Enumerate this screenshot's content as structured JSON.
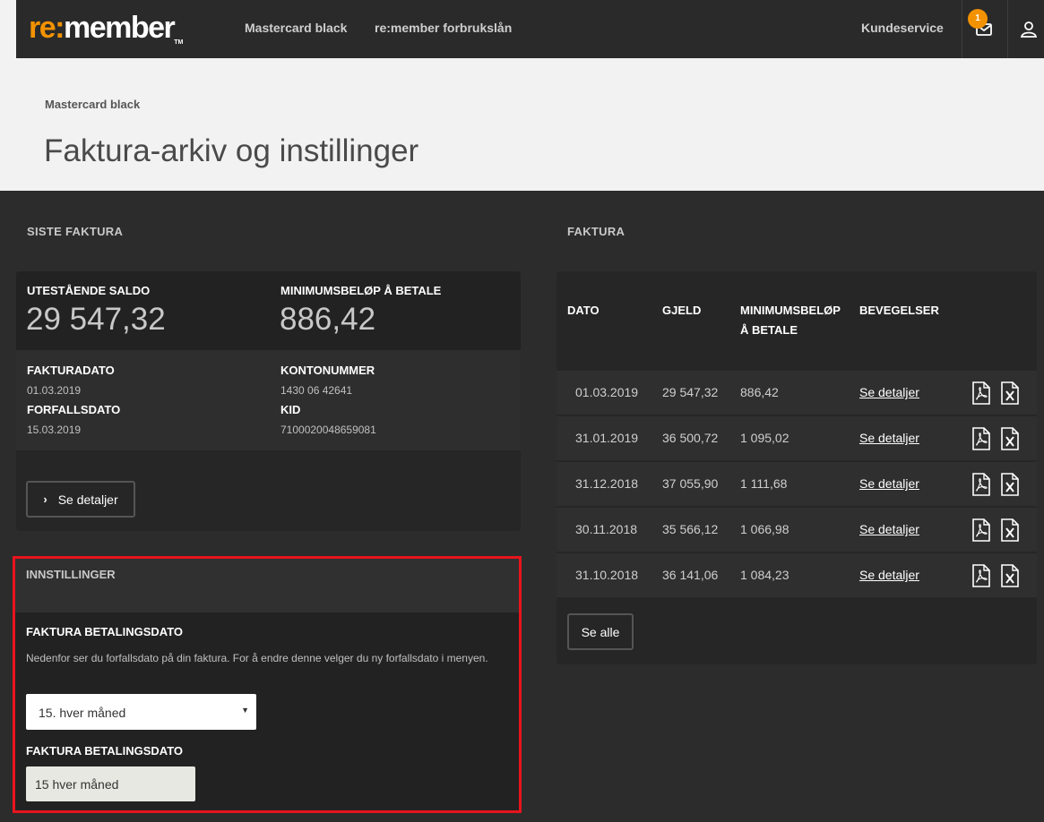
{
  "nav": {
    "logo_re": "re:",
    "logo_member": "member",
    "logo_tm": "TM",
    "link1": "Mastercard black",
    "link2": "re:member forbrukslån",
    "customer_service": "Kundeservice",
    "inbox_badge": "1"
  },
  "header": {
    "breadcrumb": "Mastercard black",
    "title": "Faktura-arkiv og instillinger"
  },
  "latest": {
    "section_title": "SISTE FAKTURA",
    "balance_label": "UTESTÅENDE SALDO",
    "balance_value": "29 547,32",
    "min_label": "MINIMUMSBELØP Å BETALE",
    "min_value": "886,42",
    "invoice_date_label": "FAKTURADATO",
    "invoice_date": "01.03.2019",
    "due_date_label": "FORFALLSDATO",
    "due_date": "15.03.2019",
    "account_label": "KONTONUMMER",
    "account": "1430 06 42641",
    "kid_label": "KID",
    "kid": "7100020048659081",
    "details_button": "Se detaljer"
  },
  "invoices": {
    "section_title": "FAKTURA",
    "headers": {
      "date": "DATO",
      "debt": "GJELD",
      "min_line1": "MINIMUMSBELØP",
      "min_line2": "Å BETALE",
      "movements": "BEVEGELSER"
    },
    "link_label": "Se detaljer",
    "rows": [
      {
        "date": "01.03.2019",
        "debt": "29 547,32",
        "min": "886,42"
      },
      {
        "date": "31.01.2019",
        "debt": "36 500,72",
        "min": "1 095,02"
      },
      {
        "date": "31.12.2018",
        "debt": "37 055,90",
        "min": "1 111,68"
      },
      {
        "date": "30.11.2018",
        "debt": "35 566,12",
        "min": "1 066,98"
      },
      {
        "date": "31.10.2018",
        "debt": "36 141,06",
        "min": "1 084,23"
      }
    ],
    "see_all": "Se alle"
  },
  "settings": {
    "title": "INNSTILLINGER",
    "payment_date_label": "FAKTURA BETALINGSDATO",
    "description": "Nedenfor ser du forfallsdato på din faktura. For å endre denne velger du ny forfallsdato i menyen.",
    "select_value": "15. hver måned",
    "current_label": "FAKTURA BETALINGSDATO",
    "current_value": "15 hver måned"
  },
  "colors": {
    "accent": "#f39200",
    "highlight_border": "#e8141c"
  }
}
